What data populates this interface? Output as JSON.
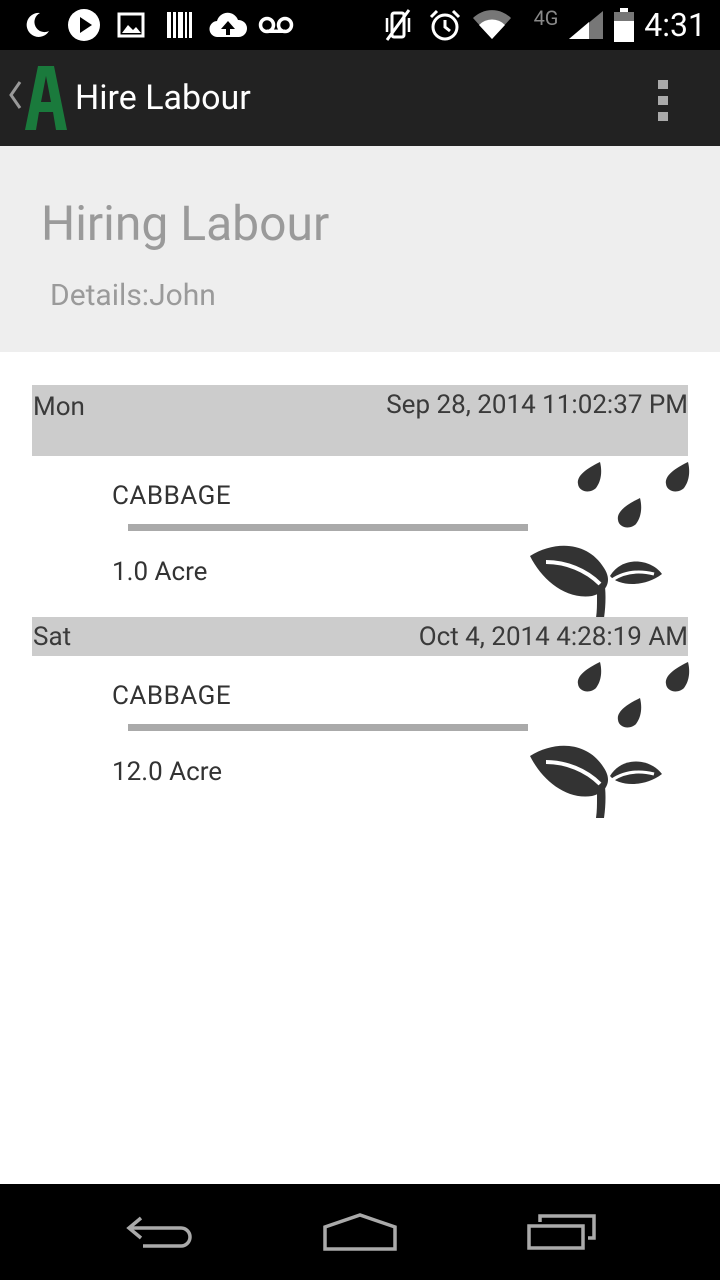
{
  "status_bar": {
    "time": "4:31",
    "network": "4G",
    "icons": [
      "moon-icon",
      "play-icon",
      "image-icon",
      "barcode-icon",
      "cloud-upload-icon",
      "voicemail-icon",
      "vibrate-off-icon",
      "alarm-icon",
      "wifi-icon",
      "signal-icon",
      "battery-icon"
    ]
  },
  "action_bar": {
    "title": "Hire Labour",
    "logo_letter": "A",
    "logo_color": "#1a7a3c"
  },
  "header": {
    "title": "Hiring Labour",
    "subtitle": "Details:John"
  },
  "entries": [
    {
      "day": "Mon",
      "datetime": "Sep 28, 2014 11:02:37 PM",
      "crop": "CABBAGE",
      "area": "1.0 Acre",
      "icon": "plant-rain-icon"
    },
    {
      "day": "Sat",
      "datetime": "Oct 4, 2014 4:28:19 AM",
      "crop": "CABBAGE",
      "area": "12.0 Acre",
      "icon": "plant-rain-icon"
    }
  ],
  "nav_bar": {
    "buttons": [
      "back-icon",
      "home-icon",
      "recents-icon"
    ]
  }
}
